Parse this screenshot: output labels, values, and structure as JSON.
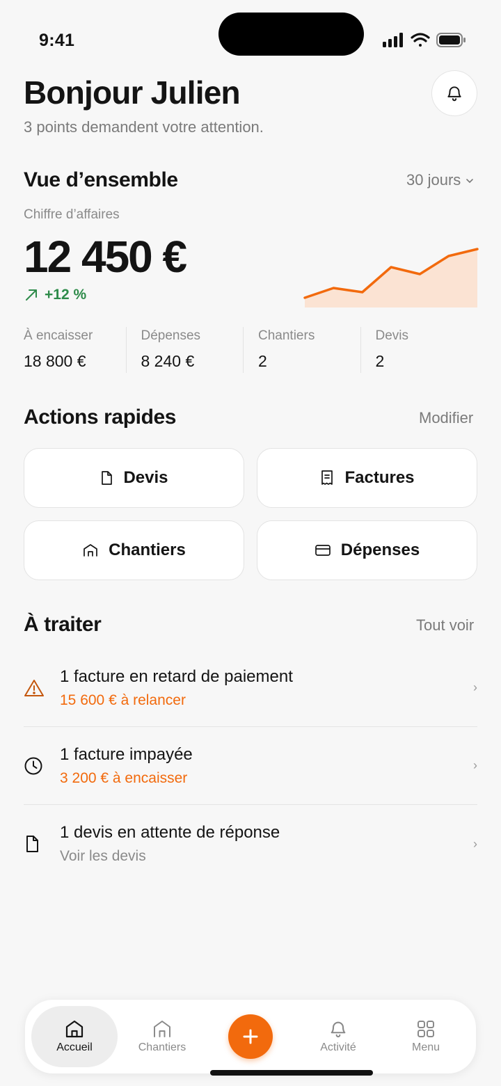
{
  "status_bar": {
    "time": "9:41"
  },
  "header": {
    "greeting": "Bonjour Julien",
    "subtitle": "3 points demandent votre attention."
  },
  "overview": {
    "title": "Vue d’ensemble",
    "period": "30 jours",
    "revenue_label": "Chiffre d’affaires",
    "revenue_value": "12 450 €",
    "trend": "+12 %",
    "sparkline": [
      30,
      23,
      26,
      8,
      13,
      0,
      -5
    ],
    "kpis": [
      {
        "label": "À encaisser",
        "value": "18 800 €"
      },
      {
        "label": "Dépenses",
        "value": "8 240 €"
      },
      {
        "label": "Chantiers",
        "value": "2"
      },
      {
        "label": "Devis",
        "value": "2"
      }
    ]
  },
  "quick_actions": {
    "title": "Actions rapides",
    "modify": "Modifier",
    "items": [
      {
        "label": "Devis",
        "icon": "document-icon"
      },
      {
        "label": "Factures",
        "icon": "receipt-icon"
      },
      {
        "label": "Chantiers",
        "icon": "house-icon"
      },
      {
        "label": "Dépenses",
        "icon": "card-icon"
      }
    ]
  },
  "todo": {
    "title": "À traiter",
    "see_all": "Tout voir",
    "items": [
      {
        "title": "1 facture en retard de paiement",
        "subtitle": "15 600 € à relancer",
        "icon": "warning-icon"
      },
      {
        "title": "1 facture impayée",
        "subtitle": "3 200 € à encaisser",
        "icon": "clock-icon"
      },
      {
        "title": "1 devis en attente de réponse",
        "subtitle": "Voir les devis",
        "icon": "document-icon"
      }
    ]
  },
  "nav": {
    "items": [
      {
        "label": "Accueil"
      },
      {
        "label": "Chantiers"
      },
      {
        "label": "Activité"
      },
      {
        "label": "Menu"
      }
    ]
  },
  "colors": {
    "accent": "#f26a0d",
    "positive": "#2e8b4a",
    "accent_fill": "#fbe3d3"
  }
}
